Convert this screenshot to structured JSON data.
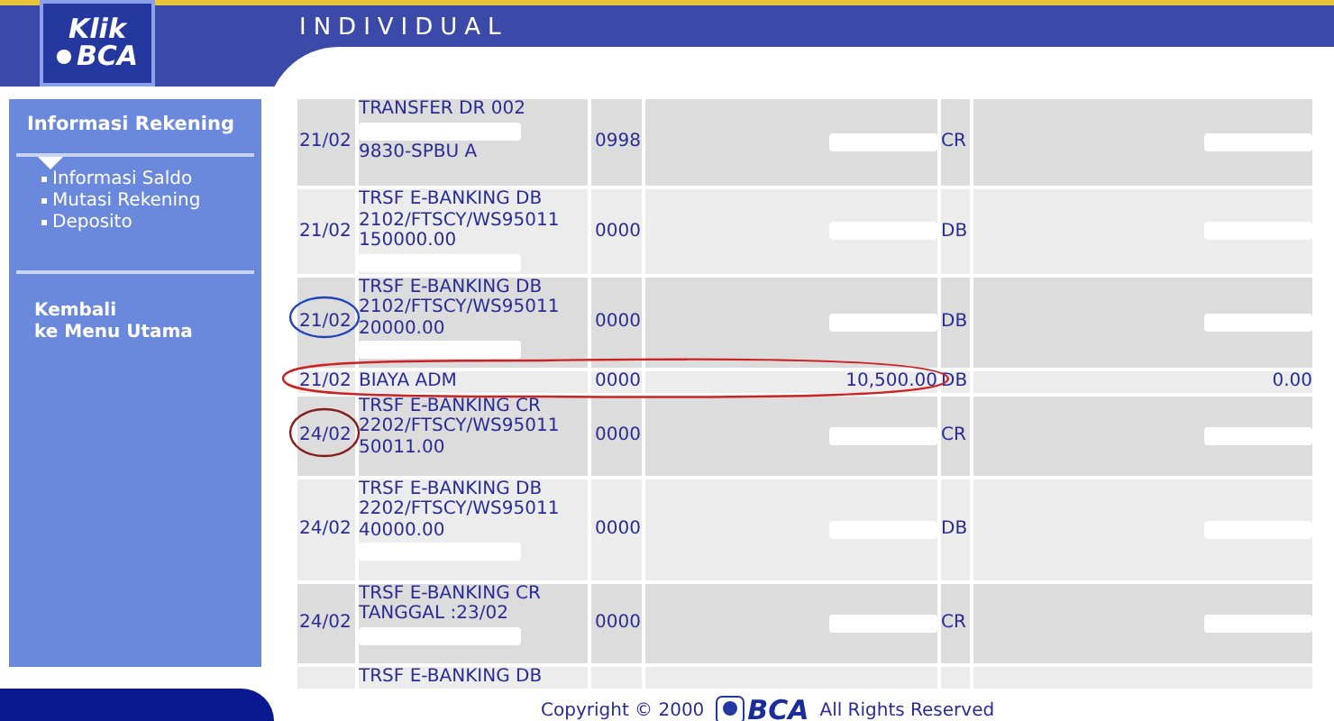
{
  "header": {
    "logo": {
      "line_1": "Klik",
      "line_2": "BCA"
    },
    "title": "INDIVIDUAL"
  },
  "sidebar": {
    "section": "Informasi Rekening",
    "items": [
      {
        "label": "Informasi Saldo"
      },
      {
        "label": "Mutasi Rekening"
      },
      {
        "label": "Deposito"
      }
    ],
    "back_link": [
      "Kembali",
      "ke Menu Utama"
    ]
  },
  "table": {
    "rows": [
      {
        "date": "21/02",
        "lines": [
          {
            "kind": "text",
            "text": "TRANSFER DR 002"
          },
          {
            "kind": "redacted"
          },
          {
            "kind": "text",
            "text": "9830-SPBU A"
          }
        ],
        "branch": "0998",
        "amount_redacted": true,
        "type": "CR",
        "balance_redacted": true
      },
      {
        "date": "21/02",
        "lines": [
          {
            "kind": "text",
            "text": "TRSF E-BANKING DB"
          },
          {
            "kind": "text",
            "text": "2102/FTSCY/WS95011"
          },
          {
            "kind": "text",
            "text": "150000.00"
          },
          {
            "kind": "redacted"
          }
        ],
        "branch": "0000",
        "amount_redacted": true,
        "type": "DB",
        "balance_redacted": true
      },
      {
        "date": "21/02",
        "lines": [
          {
            "kind": "text",
            "text": "TRSF E-BANKING DB"
          },
          {
            "kind": "text",
            "text": "2102/FTSCY/WS95011"
          },
          {
            "kind": "text",
            "text": "20000.00"
          },
          {
            "kind": "redacted"
          }
        ],
        "branch": "0000",
        "amount_redacted": true,
        "type": "DB",
        "balance_redacted": true
      },
      {
        "date": "21/02",
        "lines": [
          {
            "kind": "text",
            "text": "BIAYA ADM"
          }
        ],
        "branch": "0000",
        "amount": "10,500.00",
        "type": "DB",
        "balance": "0.00"
      },
      {
        "date": "24/02",
        "lines": [
          {
            "kind": "text",
            "text": "TRSF E-BANKING CR"
          },
          {
            "kind": "text",
            "text": "2202/FTSCY/WS95011"
          },
          {
            "kind": "text",
            "text": "50011.00"
          }
        ],
        "branch": "0000",
        "amount_redacted": true,
        "type": "CR",
        "balance_redacted": true
      },
      {
        "date": "24/02",
        "lines": [
          {
            "kind": "text",
            "text": "TRSF E-BANKING DB"
          },
          {
            "kind": "text",
            "text": "2202/FTSCY/WS95011"
          },
          {
            "kind": "text",
            "text": "40000.00"
          },
          {
            "kind": "redacted"
          }
        ],
        "branch": "0000",
        "amount_redacted": true,
        "type": "DB",
        "balance_redacted": true
      },
      {
        "date": "24/02",
        "lines": [
          {
            "kind": "text",
            "text": "TRSF E-BANKING CR"
          },
          {
            "kind": "text",
            "text": "TANGGAL :23/02"
          },
          {
            "kind": "redacted"
          }
        ],
        "branch": "0000",
        "amount_redacted": true,
        "type": "CR",
        "balance_redacted": true
      },
      {
        "lines": [
          {
            "kind": "text",
            "text": "TRSF E-BANKING DB"
          }
        ]
      }
    ]
  },
  "annotations": [
    {
      "kind": "ellipse",
      "color": "#cc2222"
    },
    {
      "kind": "circle-date",
      "color": "#2244bb"
    },
    {
      "kind": "circle-date-2",
      "color": "#881c1c"
    }
  ],
  "footer": {
    "copyright": "Copyright © 2000",
    "logo": "BCA",
    "rights": "All Rights Reserved"
  }
}
